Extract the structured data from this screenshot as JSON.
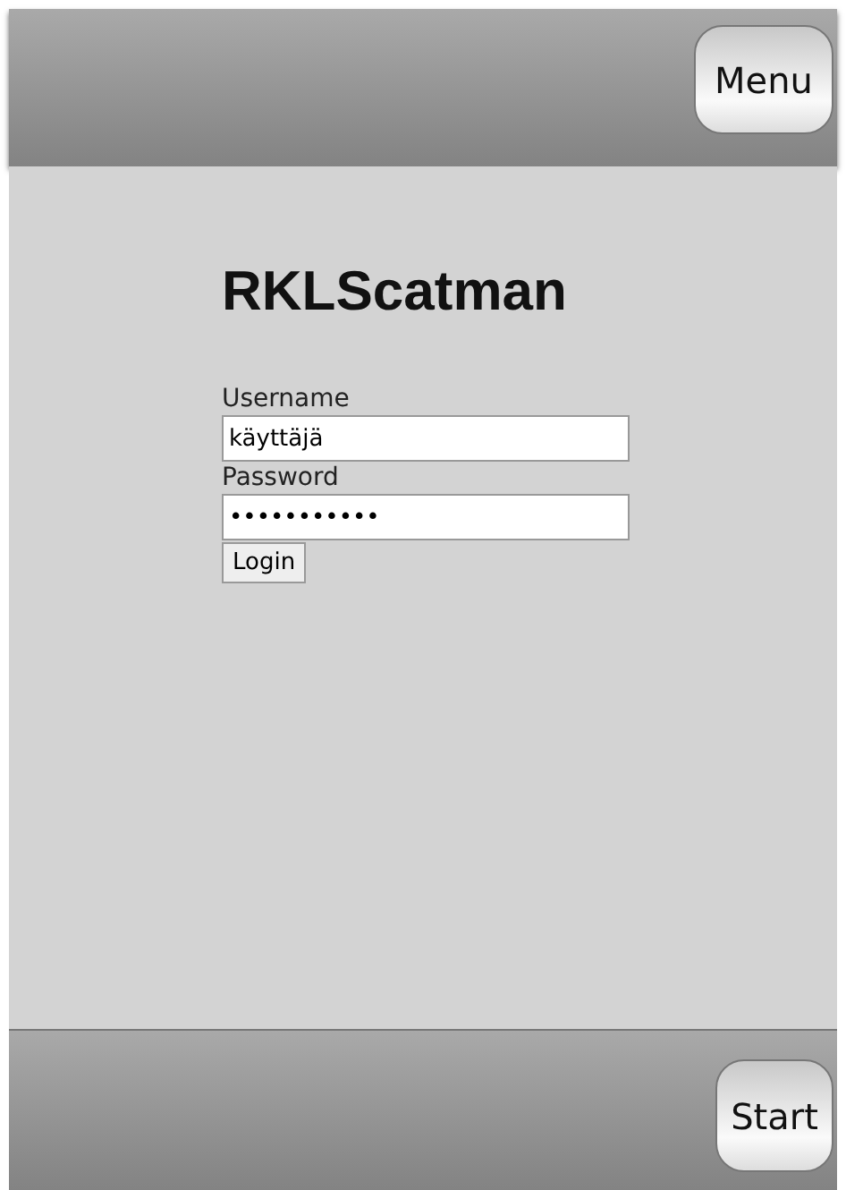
{
  "header": {
    "menu_button": "Menu"
  },
  "login": {
    "title": "RKLScatman",
    "fields": [
      {
        "label": "Username",
        "value": "käyttäjä"
      },
      {
        "label": "Password",
        "value": "•••••••••••"
      }
    ],
    "submit": "Login"
  },
  "footer": {
    "start_button": "Start"
  }
}
